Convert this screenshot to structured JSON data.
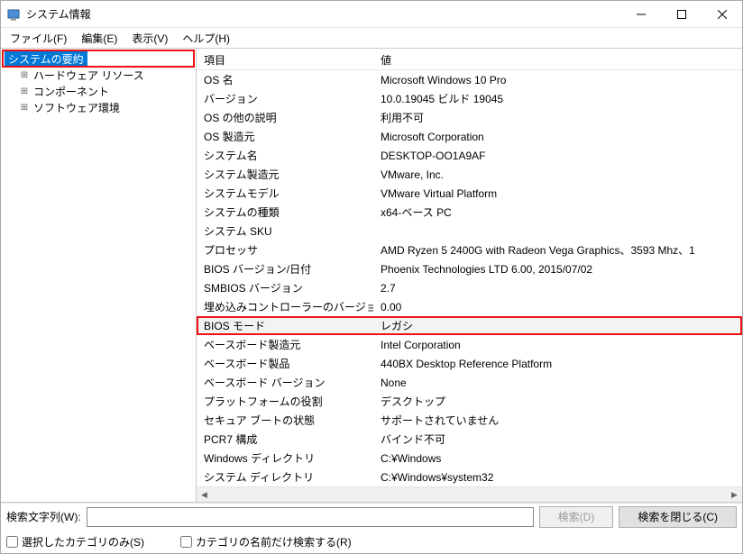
{
  "titlebar": {
    "title": "システム情報"
  },
  "menubar": {
    "file": "ファイル(F)",
    "edit": "編集(E)",
    "view": "表示(V)",
    "help": "ヘルプ(H)"
  },
  "tree": {
    "root": "システムの要約",
    "hw": "ハードウェア リソース",
    "comp": "コンポーネント",
    "sw": "ソフトウェア環境"
  },
  "grid": {
    "header_key": "項目",
    "header_val": "値",
    "rows": [
      {
        "k": "OS 名",
        "v": "Microsoft Windows 10 Pro"
      },
      {
        "k": "バージョン",
        "v": "10.0.19045 ビルド 19045"
      },
      {
        "k": "OS の他の説明",
        "v": "利用不可"
      },
      {
        "k": "OS 製造元",
        "v": "Microsoft Corporation"
      },
      {
        "k": "システム名",
        "v": "DESKTOP-OO1A9AF"
      },
      {
        "k": "システム製造元",
        "v": "VMware, Inc."
      },
      {
        "k": "システムモデル",
        "v": "VMware Virtual Platform"
      },
      {
        "k": "システムの種類",
        "v": "x64-ベース PC"
      },
      {
        "k": "システム SKU",
        "v": ""
      },
      {
        "k": "プロセッサ",
        "v": "AMD Ryzen 5 2400G with Radeon Vega Graphics、3593 Mhz、1"
      },
      {
        "k": "BIOS バージョン/日付",
        "v": "Phoenix Technologies LTD 6.00, 2015/07/02"
      },
      {
        "k": "SMBIOS バージョン",
        "v": "2.7"
      },
      {
        "k": "埋め込みコントローラーのバージョン",
        "v": "0.00"
      },
      {
        "k": "BIOS モード",
        "v": "レガシ",
        "boxed": true,
        "hl": true
      },
      {
        "k": "ベースボード製造元",
        "v": "Intel Corporation"
      },
      {
        "k": "ベースボード製品",
        "v": "440BX Desktop Reference Platform"
      },
      {
        "k": "ベースボード バージョン",
        "v": "None"
      },
      {
        "k": "プラットフォームの役割",
        "v": "デスクトップ"
      },
      {
        "k": "セキュア ブートの状態",
        "v": "サポートされていません"
      },
      {
        "k": "PCR7 構成",
        "v": "バインド不可"
      },
      {
        "k": "Windows ディレクトリ",
        "v": "C:¥Windows"
      },
      {
        "k": "システム ディレクトリ",
        "v": "C:¥Windows¥system32"
      }
    ]
  },
  "search": {
    "label": "検索文字列(W):",
    "find_btn": "検索(D)",
    "close_btn": "検索を閉じる(C)"
  },
  "checks": {
    "selected_only": "選択したカテゴリのみ(S)",
    "name_only": "カテゴリの名前だけ検索する(R)"
  }
}
